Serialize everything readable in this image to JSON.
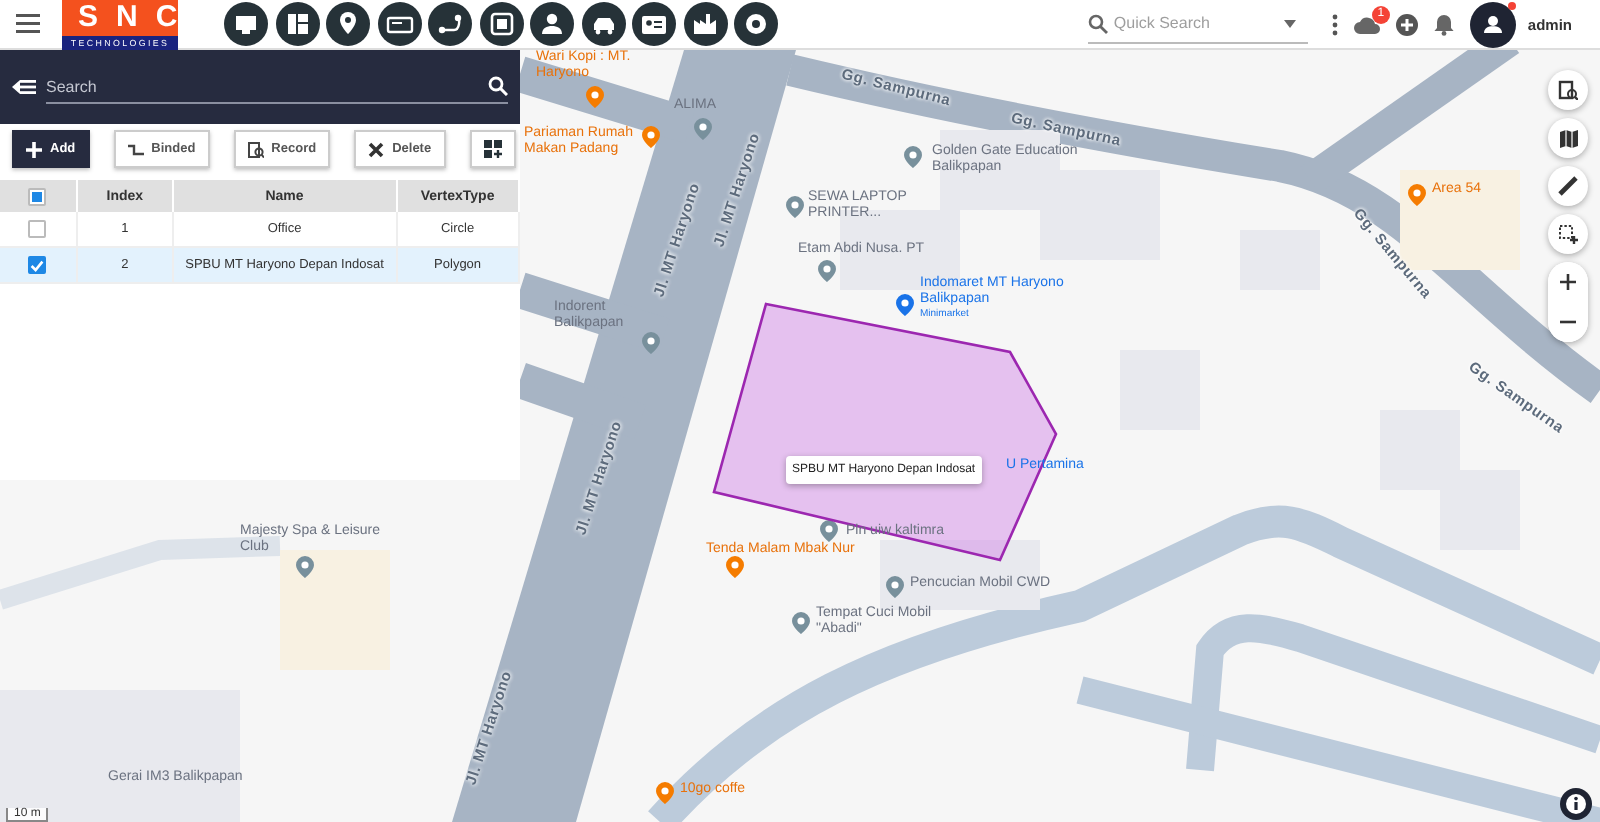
{
  "header": {
    "logo": {
      "title": "SNC",
      "subtitle": "TECHNOLOGIES"
    },
    "quick_search": {
      "placeholder": "Quick Search"
    },
    "notification_badge": "1",
    "user": {
      "name": "admin",
      "online": true
    }
  },
  "panel": {
    "search": {
      "placeholder": "Search"
    },
    "buttons": [
      {
        "label": "Add",
        "kind": "primary"
      },
      {
        "label": "Binded",
        "kind": "outline"
      },
      {
        "label": "Record",
        "kind": "outline"
      },
      {
        "label": "Delete",
        "kind": "outline"
      }
    ],
    "table": {
      "select_all": {
        "indeterminate": true
      },
      "columns": [
        "Index",
        "Name",
        "VertexType"
      ],
      "rows": [
        {
          "index": "1",
          "name": "Office",
          "vertex_type": "Circle",
          "checked": false,
          "selected": false
        },
        {
          "index": "2",
          "name": "SPBU MT Haryono Depan Indosat",
          "vertex_type": "Polygon",
          "checked": true,
          "selected": true
        }
      ]
    }
  },
  "map": {
    "labels": [
      {
        "kind": "food",
        "text": "Wari Kopi : MT. Haryono"
      },
      {
        "kind": "food",
        "text": "Pariaman Rumah Makan Padang"
      },
      {
        "kind": "place",
        "text": "ALIMA"
      },
      {
        "kind": "place",
        "text": "SEWA LAPTOP PRINTER..."
      },
      {
        "kind": "place",
        "text": "Golden Gate Education Balikpapan"
      },
      {
        "kind": "place",
        "text": "Etam Abdi Nusa. PT"
      },
      {
        "kind": "place",
        "text": "Indorent Balikpapan"
      },
      {
        "kind": "shop",
        "text": "Indomaret MT Haryono Balikpapan",
        "subtitle": "Minimarket"
      },
      {
        "kind": "food",
        "text": "Area 54"
      },
      {
        "kind": "shop",
        "text": "U Pertamina"
      },
      {
        "kind": "place",
        "text": "Pln uiw kaltimra"
      },
      {
        "kind": "food",
        "text": "Tenda Malam Mbak Nur"
      },
      {
        "kind": "place",
        "text": "Pencucian Mobil CWD"
      },
      {
        "kind": "place",
        "text": "Tempat Cuci Mobil \"Abadi\""
      },
      {
        "kind": "place",
        "text": "Majesty Spa & Leisure Club"
      },
      {
        "kind": "place",
        "text": "Gerai IM3 Balikpapan"
      },
      {
        "kind": "food",
        "text": "10go coffe"
      },
      {
        "kind": "road",
        "text": "Gg. Sampurna"
      },
      {
        "kind": "road",
        "text": "Gg. Sampurna"
      },
      {
        "kind": "road",
        "text": "Gg. Sampurna"
      },
      {
        "kind": "road",
        "text": "Gg. Sampurna"
      },
      {
        "kind": "road",
        "text": "Jl. MT Haryono"
      },
      {
        "kind": "road",
        "text": "Jl. MT Haryono"
      },
      {
        "kind": "road",
        "text": "Jl. MT Haryono"
      },
      {
        "kind": "road",
        "text": "Jl. MT Haryono"
      }
    ],
    "geofence": {
      "label": "SPBU MT Haryono Depan Indosat"
    },
    "scale": "10 m"
  }
}
